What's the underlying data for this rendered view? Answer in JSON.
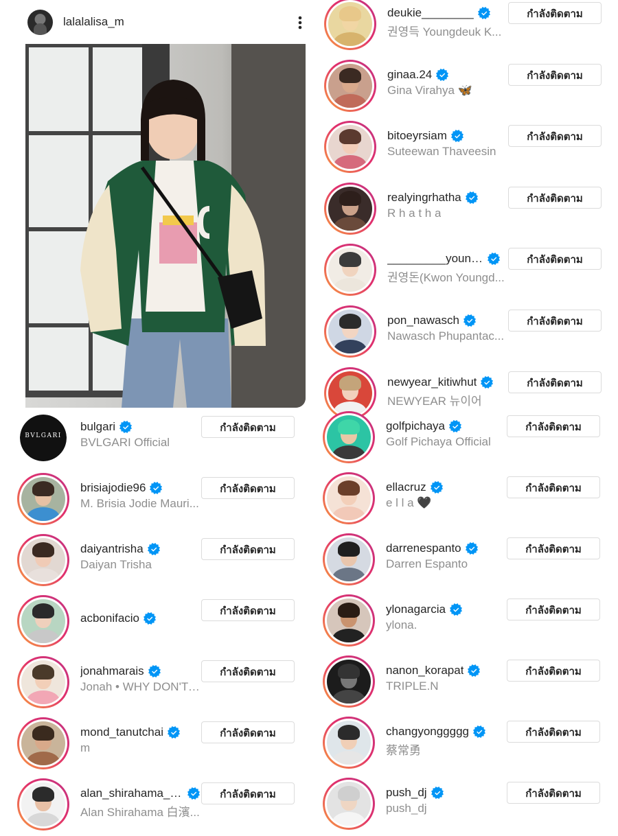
{
  "post": {
    "username": "lalalalisa_m",
    "more_icon": "more-vertical-icon"
  },
  "follow_label": "กำลังติดตาม",
  "colors": {
    "verified": "#0095f6",
    "ring_start": "#f9a03f",
    "ring_end": "#c13584",
    "secondary_text": "#8e8e8e"
  },
  "following_right_top": [
    {
      "username": "deukie________",
      "display_name": "권영득 Youngdeuk K...",
      "verified": true
    },
    {
      "username": "ginaa.24",
      "display_name": "Gina Virahya 🦋",
      "verified": true
    },
    {
      "username": "bitoeyrsiam",
      "display_name": "Suteewan Thaveesin",
      "verified": true
    },
    {
      "username": "realyingrhatha",
      "display_name": "R h a t h a",
      "verified": true
    },
    {
      "username": "_________youngmon...",
      "display_name": "권영돈(Kwon Youngd...",
      "verified": true
    },
    {
      "username": "pon_nawasch",
      "display_name": "Nawasch Phupantac...",
      "verified": true
    },
    {
      "username": "newyear_kitiwhut",
      "display_name": "NEWYEAR 뉴이어",
      "verified": true
    }
  ],
  "following_left": [
    {
      "username": "bulgari",
      "display_name": "BVLGARI Official",
      "verified": true,
      "logo_text": "BVLGARI"
    },
    {
      "username": "brisiajodie96",
      "display_name": "M. Brisia Jodie Mauri...",
      "verified": true
    },
    {
      "username": "daiyantrisha",
      "display_name": "Daiyan Trisha",
      "verified": true
    },
    {
      "username": "acbonifacio",
      "display_name": "",
      "verified": true
    },
    {
      "username": "jonahmarais",
      "display_name": "Jonah • WHY DON'T ...",
      "verified": true
    },
    {
      "username": "mond_tanutchai",
      "display_name": "m",
      "verified": true
    },
    {
      "username": "alan_shirahama_o...",
      "display_name": "Alan Shirahama 白濱...",
      "verified": true
    }
  ],
  "following_right_bottom": [
    {
      "username": "golfpichaya",
      "display_name": "Golf Pichaya Official",
      "verified": true
    },
    {
      "username": "ellacruz",
      "display_name": "e l l a 🖤",
      "verified": true
    },
    {
      "username": "darrenespanto",
      "display_name": "Darren Espanto",
      "verified": true
    },
    {
      "username": "ylonagarcia",
      "display_name": "ylona.",
      "verified": true
    },
    {
      "username": "nanon_korapat",
      "display_name": "TRIPLE.N",
      "verified": true
    },
    {
      "username": "changyonggggg",
      "display_name": "蔡常勇",
      "verified": true
    },
    {
      "username": "push_dj",
      "display_name": "push_dj",
      "verified": true
    }
  ]
}
